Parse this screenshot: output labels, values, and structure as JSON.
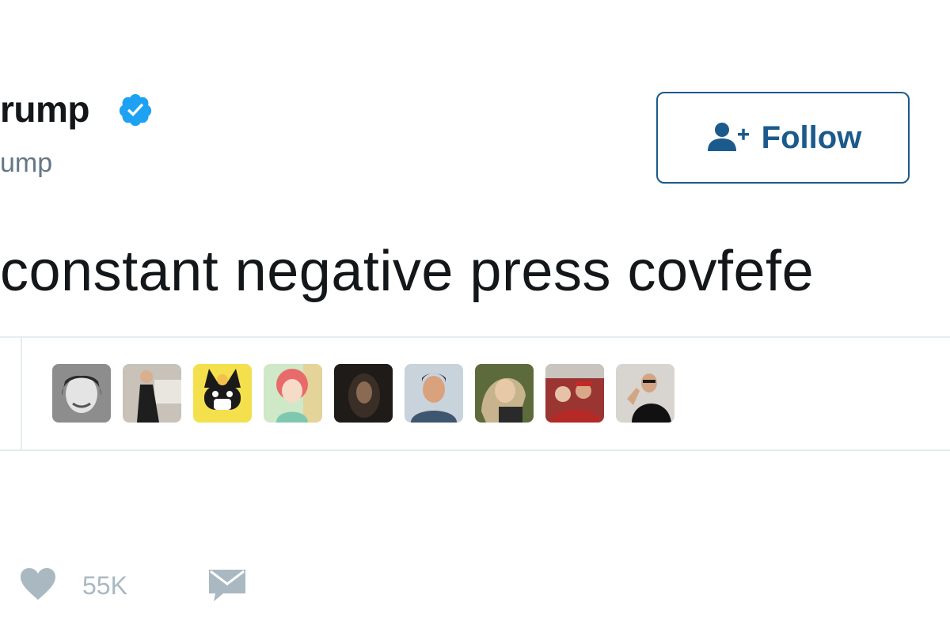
{
  "tweet": {
    "display_name": "rump",
    "handle": "ump",
    "text": "constant negative press covfefe"
  },
  "follow_button": {
    "label": "Follow"
  },
  "likers": [
    {
      "name": "liker-1",
      "bg": "#9a9a9a"
    },
    {
      "name": "liker-2",
      "bg": "#b9b0a2"
    },
    {
      "name": "liker-3",
      "bg": "#f4e04d"
    },
    {
      "name": "liker-4",
      "bg": "#cde7c9"
    },
    {
      "name": "liker-5",
      "bg": "#2b2624"
    },
    {
      "name": "liker-6",
      "bg": "#c9d3dc"
    },
    {
      "name": "liker-7",
      "bg": "#6e7d4a"
    },
    {
      "name": "liker-8",
      "bg": "#a83c38"
    },
    {
      "name": "liker-9",
      "bg": "#d8d4cf"
    }
  ],
  "actions": {
    "like_count": "55K"
  },
  "colors": {
    "accent": "#1da1f2",
    "follow_border": "#1b5a8c",
    "muted": "#aab8c2",
    "divider": "#e6ecf0"
  },
  "icons": [
    "verified-badge-icon",
    "add-user-icon",
    "heart-icon",
    "envelope-icon"
  ]
}
